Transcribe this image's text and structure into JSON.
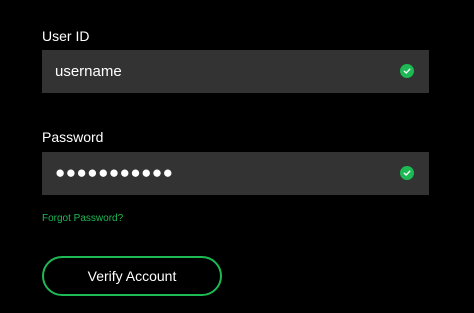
{
  "form": {
    "user_id_label": "User ID",
    "user_id_value": "username",
    "password_label": "Password",
    "password_mask": "●●●●●●●●●●●",
    "forgot_password": "Forgot Password?",
    "verify_button": "Verify Account"
  },
  "icons": {
    "user_status": "check-circle-icon",
    "password_status": "check-circle-icon"
  },
  "colors": {
    "background": "#000000",
    "field_background": "#333333",
    "accent": "#1db954",
    "text": "#ffffff"
  }
}
